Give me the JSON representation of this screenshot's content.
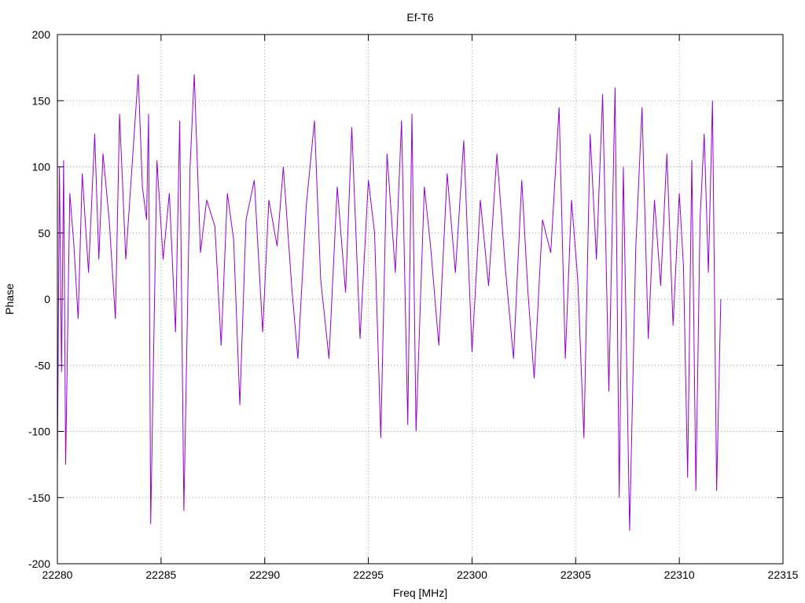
{
  "chart_data": {
    "type": "line",
    "title": "Ef-T6",
    "xlabel": "Freq [MHz]",
    "ylabel": "Phase",
    "xlim": [
      22280,
      22315
    ],
    "ylim": [
      -200,
      200
    ],
    "xticks": [
      22280,
      22285,
      22290,
      22295,
      22300,
      22305,
      22310,
      22315
    ],
    "yticks": [
      -200,
      -150,
      -100,
      -50,
      0,
      50,
      100,
      150,
      200
    ],
    "grid": true,
    "legend": "none",
    "series": [
      {
        "color": "#9400d3",
        "x": [
          22280.0,
          22280.1,
          22280.2,
          22280.3,
          22280.4,
          22280.6,
          22280.8,
          22281.0,
          22281.2,
          22281.5,
          22281.8,
          22282.0,
          22282.2,
          22282.5,
          22282.8,
          22283.0,
          22283.3,
          22283.6,
          22283.9,
          22284.1,
          22284.3,
          22284.4,
          22284.5,
          22284.8,
          22285.1,
          22285.4,
          22285.7,
          22285.9,
          22286.1,
          22286.4,
          22286.6,
          22286.9,
          22287.2,
          22287.6,
          22287.9,
          22288.2,
          22288.5,
          22288.8,
          22289.1,
          22289.5,
          22289.9,
          22290.2,
          22290.6,
          22290.9,
          22291.3,
          22291.6,
          22292.0,
          22292.4,
          22292.7,
          22293.1,
          22293.5,
          22293.9,
          22294.2,
          22294.6,
          22295.0,
          22295.3,
          22295.6,
          22295.9,
          22296.3,
          22296.6,
          22296.9,
          22297.1,
          22297.3,
          22297.7,
          22298.0,
          22298.4,
          22298.8,
          22299.2,
          22299.6,
          22300.0,
          22300.4,
          22300.8,
          22301.2,
          22301.6,
          22302.0,
          22302.4,
          22302.7,
          22303.0,
          22303.4,
          22303.8,
          22304.2,
          22304.5,
          22304.8,
          22305.1,
          22305.4,
          22305.7,
          22306.0,
          22306.3,
          22306.6,
          22306.9,
          22307.1,
          22307.3,
          22307.6,
          22307.9,
          22308.2,
          22308.5,
          22308.8,
          22309.1,
          22309.4,
          22309.7,
          22310.0,
          22310.2,
          22310.4,
          22310.6,
          22310.8,
          22311.0,
          22311.2,
          22311.4,
          22311.6,
          22311.8,
          22312.0
        ],
        "y": [
          -130,
          100,
          -55,
          105,
          -125,
          80,
          40,
          -15,
          95,
          20,
          125,
          30,
          110,
          60,
          -15,
          140,
          30,
          100,
          170,
          85,
          60,
          140,
          -170,
          105,
          30,
          80,
          -25,
          135,
          -160,
          100,
          170,
          35,
          75,
          55,
          -35,
          80,
          45,
          -80,
          60,
          90,
          -25,
          75,
          40,
          100,
          10,
          -45,
          70,
          135,
          15,
          -45,
          85,
          5,
          130,
          -30,
          90,
          50,
          -105,
          110,
          20,
          135,
          -95,
          140,
          -100,
          85,
          40,
          -35,
          95,
          20,
          120,
          -40,
          75,
          10,
          110,
          25,
          -45,
          90,
          5,
          -60,
          60,
          35,
          145,
          -45,
          75,
          15,
          -105,
          125,
          30,
          155,
          -70,
          160,
          -150,
          100,
          -175,
          40,
          145,
          -30,
          75,
          10,
          110,
          -20,
          80,
          25,
          -135,
          105,
          -145,
          60,
          125,
          20,
          150,
          -145,
          0
        ]
      }
    ]
  }
}
